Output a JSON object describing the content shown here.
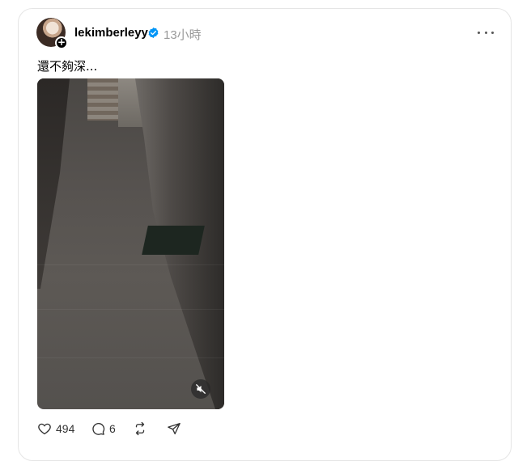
{
  "post": {
    "username": "lekimberleyy",
    "time_ago": "13小時",
    "caption": "還不夠深...",
    "verified": true,
    "media_type": "video",
    "muted": true
  },
  "actions": {
    "likes": "494",
    "replies": "6"
  },
  "icons": {
    "avatar_badge": "plus-icon",
    "verified": "verified-badge-icon",
    "more": "more-options-icon",
    "mute": "volume-muted-icon",
    "like": "heart-icon",
    "reply": "comment-icon",
    "repost": "repost-icon",
    "share": "share-icon"
  },
  "colors": {
    "verified_blue": "#0095f6",
    "muted_text": "#999999",
    "border": "#e5e5e5"
  }
}
